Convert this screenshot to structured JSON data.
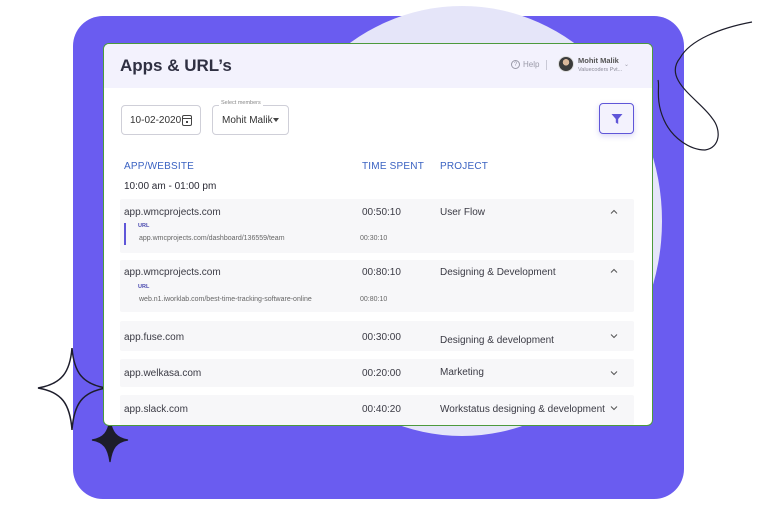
{
  "app": {
    "title": "Apps & URL’s"
  },
  "header": {
    "help_label": "Help",
    "help_icon": "help-circle-icon",
    "user_name": "Mohit Malik",
    "user_org": "Valuecoders Pvt...",
    "chevron_icon": "chevron-down-icon"
  },
  "filters": {
    "date_value": "10-02-2020",
    "date_icon": "calendar-icon",
    "member_label": "Select members",
    "member_value": "Mohit Malik",
    "filter_icon": "filter-icon"
  },
  "table": {
    "columns": [
      "APP/WEBSITE",
      "TIME SPENT",
      "PROJECT"
    ],
    "time_range": "10:00 am - 01:00 pm",
    "rows": [
      {
        "app": "app.wmcprojects.com",
        "time": "00:50:10",
        "project": "User Flow",
        "expanded": true,
        "url_label": "URL",
        "url": "app.wmcprojects.com/dashboard/136559/team",
        "url_time": "00:30:10"
      },
      {
        "app": "app.wmcprojects.com",
        "time": "00:80:10",
        "project": "Designing & Development",
        "expanded": true,
        "url_label": "URL",
        "url": "web.n1.iworklab.com/best-time-tracking-software-online",
        "url_time": "00:80:10"
      },
      {
        "app": "app.fuse.com",
        "time": "00:30:00",
        "project": "Designing & development",
        "expanded": false
      },
      {
        "app": "app.welkasa.com",
        "time": "00:20:00",
        "project": "Marketing",
        "expanded": false
      },
      {
        "app": "app.slack.com",
        "time": "00:40:20",
        "project": "Workstatus designing & development",
        "expanded": false
      }
    ]
  },
  "colors": {
    "accent": "#5f56d8",
    "frame": "#6a5cf0",
    "header_bg": "#f3f2fd",
    "column_header": "#3a62c2",
    "window_border": "#4c9a3c"
  }
}
